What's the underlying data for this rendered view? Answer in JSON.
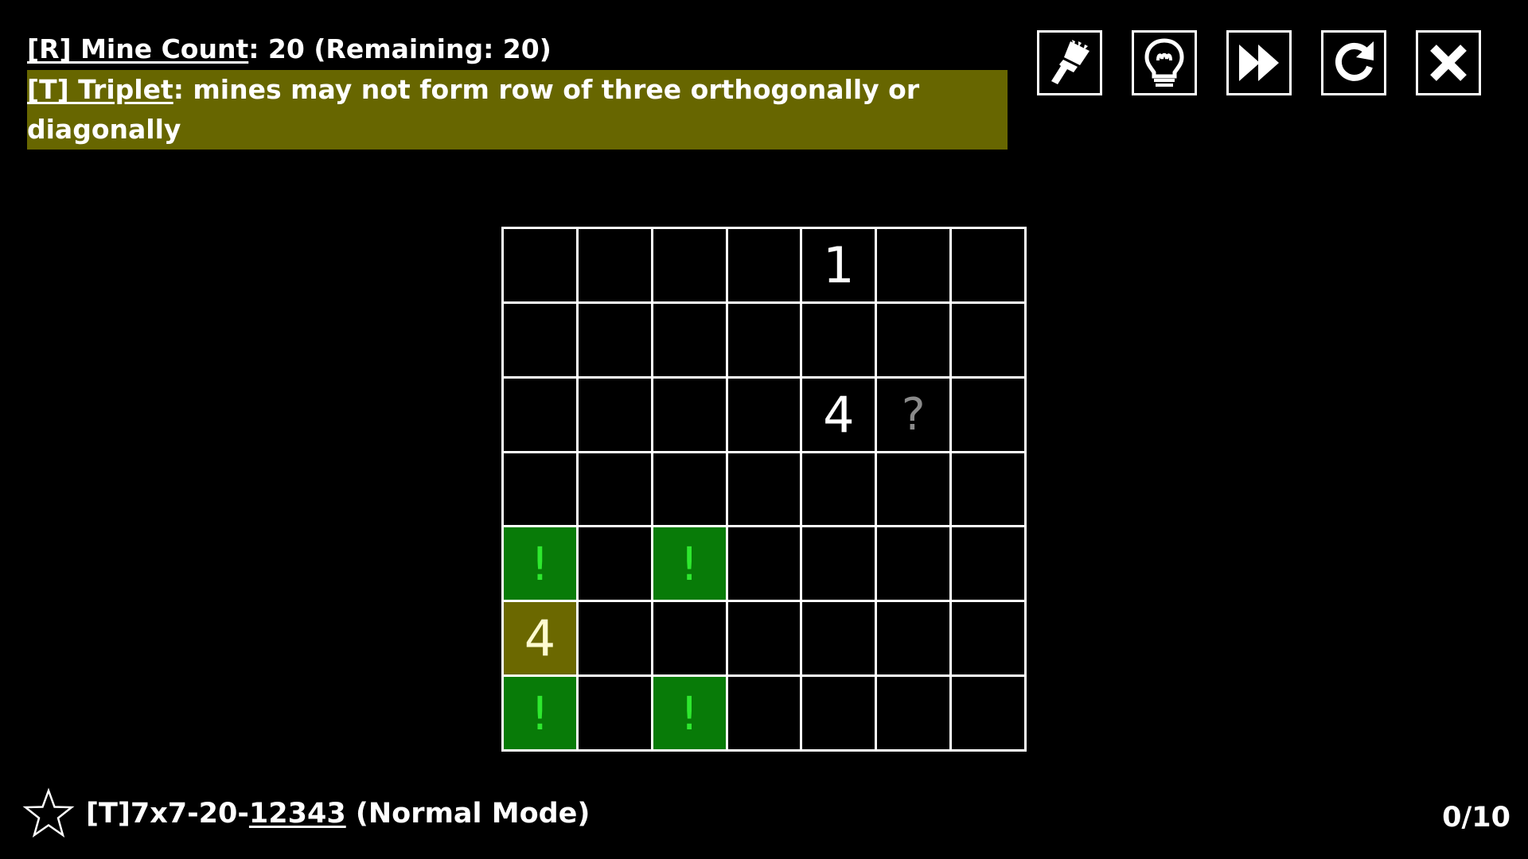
{
  "rules": {
    "mine_count": {
      "tag": "[R] Mine Count",
      "text": ":  20 (Remaining: 20)"
    },
    "triplet": {
      "tag": "[T] Triplet",
      "text": ": mines may not form row of three orthogonally or diagonally",
      "highlight_color": "#676600"
    }
  },
  "toolbar": {
    "buttons": [
      {
        "name": "brush-icon"
      },
      {
        "name": "hint-lightbulb-icon"
      },
      {
        "name": "fast-forward-icon"
      },
      {
        "name": "restart-icon"
      },
      {
        "name": "close-icon"
      }
    ]
  },
  "board": {
    "rows": 7,
    "cols": 7,
    "cells": [
      [
        "",
        "",
        "",
        "",
        "1",
        "",
        ""
      ],
      [
        "",
        "",
        "",
        "",
        "",
        "",
        ""
      ],
      [
        "",
        "",
        "",
        "",
        "4",
        "?",
        ""
      ],
      [
        "",
        "",
        "",
        "",
        "",
        "",
        ""
      ],
      [
        "!",
        "",
        "!",
        "",
        "",
        "",
        ""
      ],
      [
        "4",
        "",
        "",
        "",
        "",
        "",
        ""
      ],
      [
        "!",
        "",
        "!",
        "",
        "",
        "",
        ""
      ]
    ],
    "flag_color": "#087b08",
    "highlight_color": "#6b6800"
  },
  "footer": {
    "prefix": "[T]7x7-20-",
    "seed": "12343",
    "mode": " (Normal Mode)",
    "progress": "0/10"
  }
}
